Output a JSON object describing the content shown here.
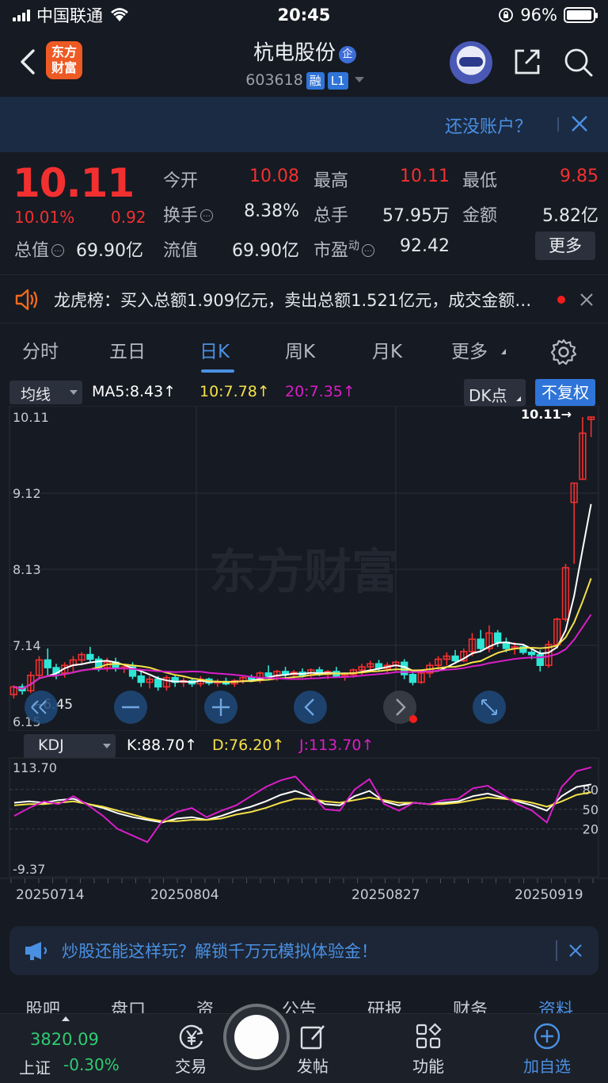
{
  "status": {
    "carrier": "中国联通",
    "time": "20:45",
    "battery": "96%",
    "battery_level": 0.96
  },
  "header": {
    "logo_line1": "东方",
    "logo_line2": "财富",
    "stock_name": "杭电股份",
    "ent_badge": "企",
    "code": "603618",
    "tag1": "融",
    "tag2": "L1"
  },
  "account_banner": {
    "text": "还没账户？"
  },
  "quote": {
    "price": "10.11",
    "change_pct": "10.01%",
    "change_amt": "0.92",
    "market_cap_label": "总值",
    "market_cap_value": "69.90亿",
    "rows": [
      [
        {
          "label": "今开",
          "value": "10.08",
          "color": "#f23030"
        },
        {
          "label": "最高",
          "value": "10.11",
          "color": "#f23030"
        },
        {
          "label": "最低",
          "value": "9.85",
          "color": "#f23030"
        }
      ],
      [
        {
          "label": "换手",
          "value": "8.38%",
          "color": "#e4e7ec"
        },
        {
          "label": "总手",
          "value": "57.95万",
          "color": "#e4e7ec"
        },
        {
          "label": "金额",
          "value": "5.82亿",
          "color": "#e4e7ec"
        }
      ],
      [
        {
          "label": "流值",
          "value": "69.90亿",
          "color": "#e4e7ec"
        },
        {
          "label": "市盈",
          "label_sup": "动",
          "value": "92.42",
          "color": "#e4e7ec"
        }
      ]
    ],
    "more_label": "更多"
  },
  "lhb": {
    "text": "龙虎榜：买入总额1.909亿元，卖出总额1.521亿元，成交金额占总成交额比例"
  },
  "tabs": [
    {
      "label": "分时"
    },
    {
      "label": "五日"
    },
    {
      "label": "日K"
    },
    {
      "label": "周K"
    },
    {
      "label": "月K"
    },
    {
      "label": "更多"
    }
  ],
  "ktool": {
    "ma_select": "均线",
    "ma5": "MA5:8.43",
    "ma10": "10:7.78",
    "ma20": "20:7.35",
    "dk_label": "DK点",
    "adjust_label": "不复权"
  },
  "kdj_bar": {
    "select": "KDJ",
    "k": "K:88.70",
    "d": "D:76.20",
    "j": "J:113.70"
  },
  "colors": {
    "up": "#f23030",
    "down": "#2ee6d6",
    "ma5": "#ffffff",
    "ma10": "#f5e14a",
    "ma20": "#d81ec8",
    "accent": "#4a90e2"
  },
  "chart_data": [
    {
      "type": "candlestick",
      "title": "",
      "y_ticks": [
        "10.11",
        "9.12",
        "8.13",
        "7.14",
        "6.15"
      ],
      "ylim": [
        6.15,
        10.11
      ],
      "last_price_label": "10.11→",
      "low_label": "←6.45",
      "candles": [
        [
          6.5,
          6.62,
          6.45,
          6.6
        ],
        [
          6.6,
          6.64,
          6.5,
          6.55
        ],
        [
          6.55,
          6.8,
          6.52,
          6.75
        ],
        [
          6.75,
          7.0,
          6.7,
          6.95
        ],
        [
          6.95,
          7.1,
          6.75,
          6.85
        ],
        [
          6.85,
          6.9,
          6.7,
          6.78
        ],
        [
          6.78,
          6.92,
          6.72,
          6.88
        ],
        [
          6.88,
          7.0,
          6.8,
          6.95
        ],
        [
          6.95,
          7.05,
          6.88,
          7.02
        ],
        [
          7.02,
          7.12,
          6.92,
          6.96
        ],
        [
          6.96,
          7.0,
          6.8,
          6.85
        ],
        [
          6.85,
          6.98,
          6.8,
          6.92
        ],
        [
          6.92,
          6.98,
          6.8,
          6.84
        ],
        [
          6.84,
          6.9,
          6.78,
          6.86
        ],
        [
          6.86,
          6.92,
          6.7,
          6.74
        ],
        [
          6.74,
          6.8,
          6.6,
          6.66
        ],
        [
          6.66,
          6.74,
          6.58,
          6.7
        ],
        [
          6.7,
          6.74,
          6.55,
          6.6
        ],
        [
          6.6,
          6.75,
          6.55,
          6.72
        ],
        [
          6.72,
          6.76,
          6.6,
          6.66
        ],
        [
          6.66,
          6.72,
          6.6,
          6.68
        ],
        [
          6.68,
          6.72,
          6.6,
          6.64
        ],
        [
          6.64,
          6.74,
          6.6,
          6.7
        ],
        [
          6.7,
          6.72,
          6.62,
          6.65
        ],
        [
          6.65,
          6.7,
          6.6,
          6.67
        ],
        [
          6.67,
          6.72,
          6.62,
          6.64
        ],
        [
          6.64,
          6.7,
          6.6,
          6.68
        ],
        [
          6.68,
          6.75,
          6.64,
          6.72
        ],
        [
          6.72,
          6.76,
          6.66,
          6.7
        ],
        [
          6.7,
          6.8,
          6.65,
          6.78
        ],
        [
          6.78,
          6.88,
          6.7,
          6.74
        ],
        [
          6.74,
          6.82,
          6.68,
          6.8
        ],
        [
          6.8,
          6.86,
          6.72,
          6.76
        ],
        [
          6.76,
          6.82,
          6.7,
          6.79
        ],
        [
          6.79,
          6.84,
          6.72,
          6.75
        ],
        [
          6.75,
          6.84,
          6.72,
          6.82
        ],
        [
          6.82,
          6.86,
          6.74,
          6.76
        ],
        [
          6.76,
          6.82,
          6.7,
          6.8
        ],
        [
          6.8,
          6.86,
          6.72,
          6.74
        ],
        [
          6.74,
          6.78,
          6.68,
          6.76
        ],
        [
          6.76,
          6.84,
          6.72,
          6.82
        ],
        [
          6.82,
          6.9,
          6.76,
          6.86
        ],
        [
          6.86,
          6.94,
          6.8,
          6.9
        ],
        [
          6.9,
          6.95,
          6.8,
          6.84
        ],
        [
          6.84,
          6.92,
          6.78,
          6.88
        ],
        [
          6.88,
          6.94,
          6.8,
          6.92
        ],
        [
          6.92,
          6.96,
          6.7,
          6.76
        ],
        [
          6.76,
          6.82,
          6.62,
          6.66
        ],
        [
          6.66,
          6.8,
          6.64,
          6.78
        ],
        [
          6.78,
          6.92,
          6.72,
          6.88
        ],
        [
          6.88,
          7.0,
          6.82,
          6.96
        ],
        [
          6.96,
          7.05,
          6.88,
          7.0
        ],
        [
          7.0,
          7.08,
          6.9,
          6.94
        ],
        [
          6.94,
          7.1,
          6.92,
          7.06
        ],
        [
          7.06,
          7.3,
          7.0,
          7.22
        ],
        [
          7.22,
          7.34,
          7.05,
          7.1
        ],
        [
          7.1,
          7.4,
          7.05,
          7.3
        ],
        [
          7.3,
          7.34,
          7.12,
          7.18
        ],
        [
          7.18,
          7.24,
          7.05,
          7.1
        ],
        [
          7.1,
          7.18,
          7.02,
          7.12
        ],
        [
          7.12,
          7.16,
          7.02,
          7.05
        ],
        [
          7.05,
          7.1,
          6.96,
          7.02
        ],
        [
          7.02,
          7.08,
          6.8,
          6.88
        ],
        [
          6.88,
          7.2,
          6.85,
          7.15
        ],
        [
          7.15,
          7.5,
          7.1,
          7.48
        ],
        [
          7.48,
          8.2,
          7.45,
          8.15
        ],
        [
          9.0,
          9.25,
          8.2,
          9.25
        ],
        [
          9.3,
          10.11,
          9.3,
          9.9
        ],
        [
          10.08,
          10.11,
          9.85,
          10.11
        ]
      ]
    },
    {
      "type": "line",
      "title": "",
      "y_ticks": [
        "113.70",
        "-9.37"
      ],
      "ylim": [
        -9.37,
        113.7
      ],
      "ref_lines": [
        80,
        50,
        20
      ],
      "x_ticks": [
        "20250714",
        "20250804",
        "20250827",
        "20250919"
      ],
      "series": [
        {
          "name": "K",
          "values": [
            60,
            62,
            60,
            64,
            66,
            58,
            52,
            44,
            38,
            34,
            30,
            36,
            38,
            34,
            40,
            48,
            54,
            62,
            72,
            78,
            70,
            58,
            56,
            70,
            78,
            62,
            56,
            60,
            58,
            60,
            62,
            70,
            74,
            68,
            62,
            56,
            48,
            70,
            84,
            88
          ]
        },
        {
          "name": "D",
          "values": [
            56,
            58,
            58,
            60,
            62,
            58,
            54,
            48,
            42,
            36,
            32,
            32,
            34,
            34,
            36,
            42,
            46,
            52,
            60,
            66,
            66,
            62,
            60,
            64,
            68,
            64,
            60,
            60,
            58,
            58,
            60,
            64,
            68,
            66,
            64,
            60,
            54,
            62,
            72,
            76
          ]
        },
        {
          "name": "J",
          "values": [
            40,
            52,
            62,
            58,
            70,
            56,
            40,
            20,
            10,
            0,
            32,
            46,
            52,
            38,
            48,
            56,
            70,
            84,
            94,
            100,
            76,
            50,
            48,
            80,
            96,
            58,
            48,
            60,
            58,
            64,
            66,
            82,
            86,
            72,
            58,
            48,
            30,
            84,
            108,
            114
          ]
        }
      ]
    }
  ],
  "promo": {
    "text": "炒股还能这样玩？解锁千万元模拟体验金！"
  },
  "section_tabs": [
    "股吧",
    "盘口",
    "资",
    "公告",
    "研报",
    "财务",
    "资料"
  ],
  "bottom": {
    "index_value": "3820.09",
    "index_name": "上证",
    "index_change": "-0.30%",
    "trade": "交易",
    "post": "发帖",
    "func": "功能",
    "watch": "加自选"
  }
}
